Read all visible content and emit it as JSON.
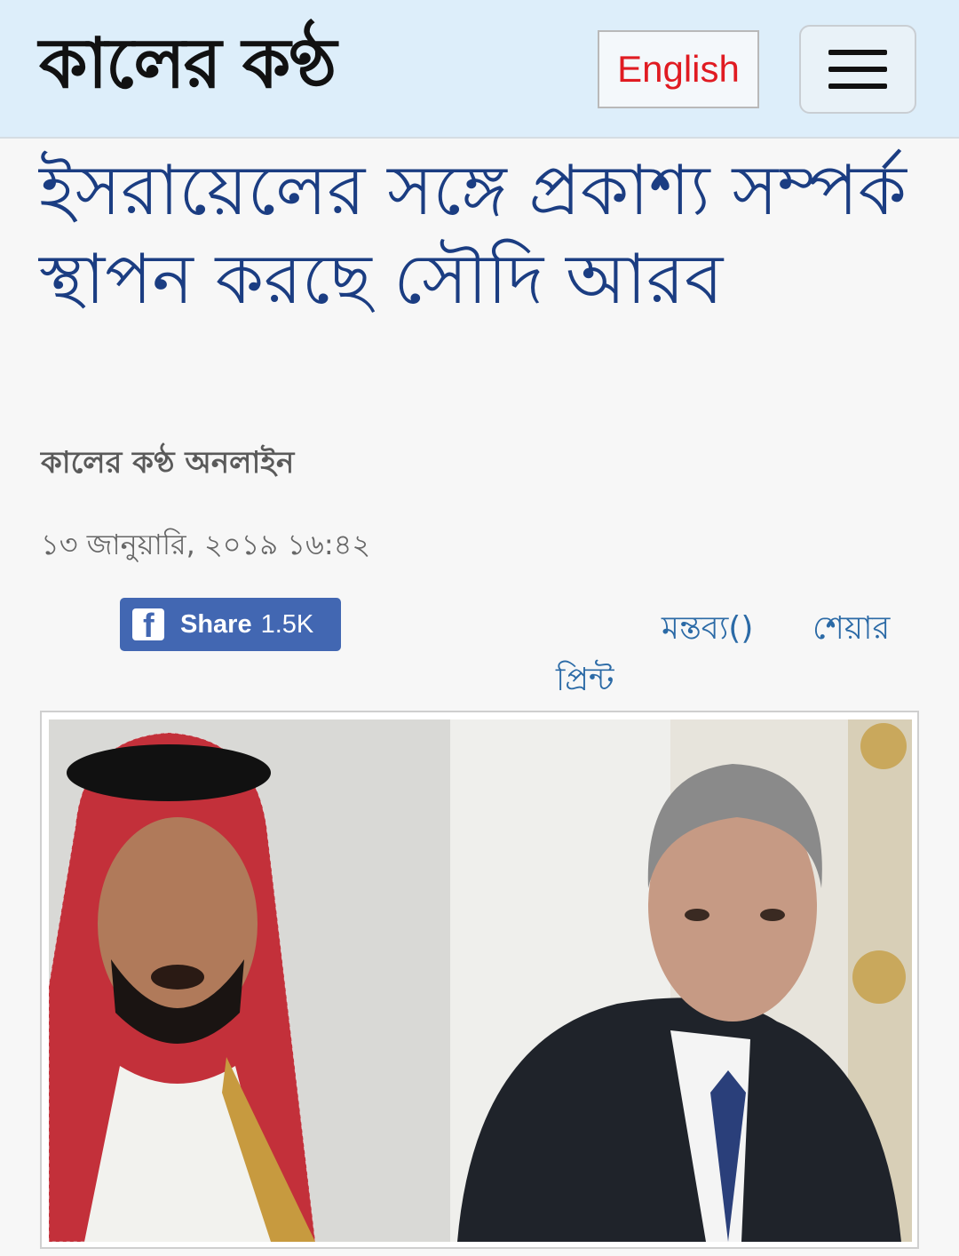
{
  "header": {
    "logo_text": "কালের কণ্ঠ",
    "language_label": "English"
  },
  "article": {
    "headline": "ইসরায়েলের সঙ্গে প্রকাশ্য সম্পর্ক স্থাপন করছে সৌদি আরব",
    "author": "কালের কণ্ঠ অনলাইন",
    "date": "১৩ জানুয়ারি, ২০১৯ ১৬:৪২"
  },
  "actions": {
    "fb_share_label": "Share",
    "fb_share_count": "1.5K",
    "comment_label": "মন্তব্য()",
    "share_label": "শেয়ার",
    "print_label": "প্রিন্ট"
  },
  "colors": {
    "header_bg": "#ddeefa",
    "headline": "#1b3d82",
    "english_red": "#e01b22",
    "facebook_blue": "#4267b2",
    "link_blue": "#2b6aa6"
  },
  "icons": [
    "hamburger-menu-icon",
    "facebook-icon"
  ]
}
